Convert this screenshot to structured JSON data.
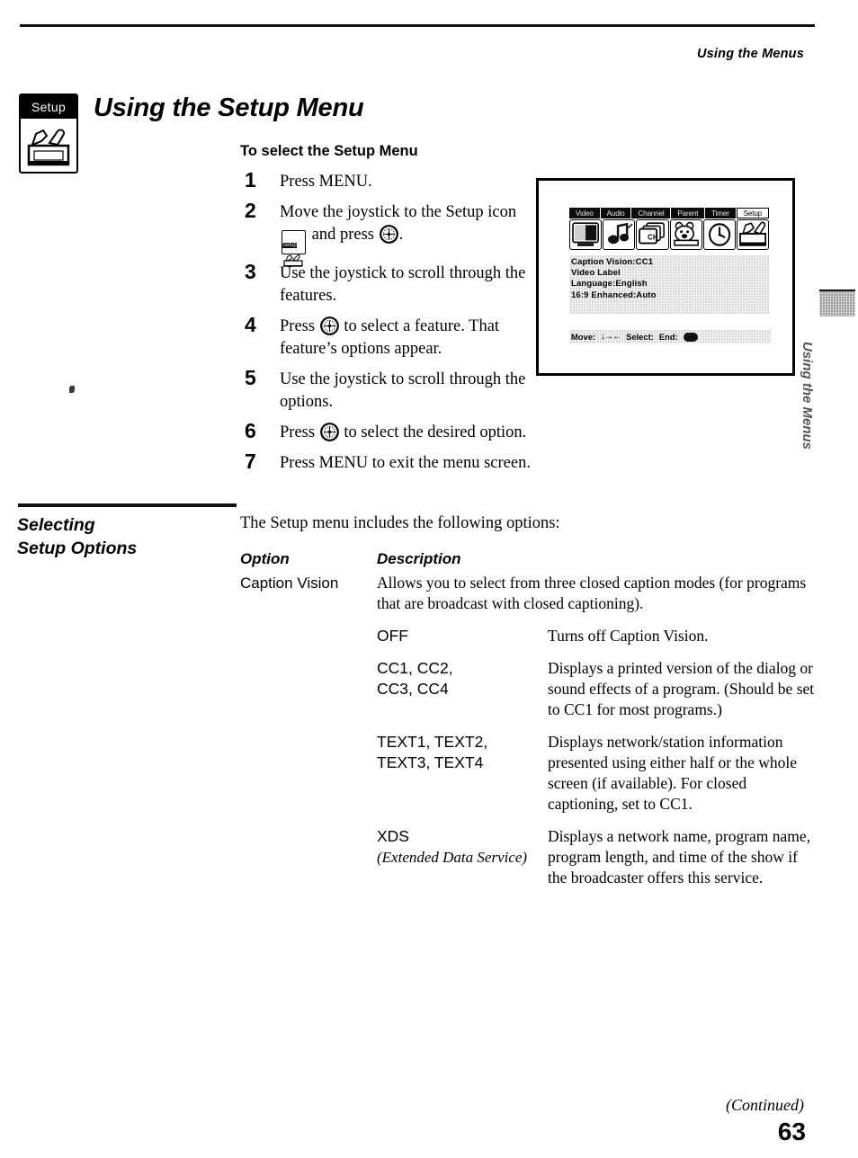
{
  "header": {
    "running_head": "Using the Menus"
  },
  "title": {
    "text": "Using the Setup Menu",
    "margin_icon_label": "Setup"
  },
  "procedure": {
    "subhead": "To select the Setup Menu",
    "steps": [
      {
        "num": "1",
        "before": "Press MENU.",
        "after": "",
        "icons": []
      },
      {
        "num": "2",
        "before": "Move the joystick to the Setup icon",
        "after": "and press",
        "tail": ".",
        "icons": [
          "setup-chip",
          "joystick"
        ]
      },
      {
        "num": "3",
        "before": "Use the joystick to scroll through the features.",
        "after": "",
        "icons": []
      },
      {
        "num": "4",
        "before": "Press",
        "after": "to select a feature. That feature’s options appear.",
        "icons": [
          "joystick"
        ]
      },
      {
        "num": "5",
        "before": "Use the joystick to scroll through the options.",
        "after": "",
        "icons": []
      },
      {
        "num": "6",
        "before": "Press",
        "after": "to select the desired option.",
        "icons": [
          "joystick"
        ]
      },
      {
        "num": "7",
        "before": "Press MENU to exit the menu screen.",
        "after": "",
        "icons": []
      }
    ]
  },
  "tv_screen": {
    "tabs": [
      {
        "label": "Video",
        "selected": false,
        "icon": "video-icon"
      },
      {
        "label": "Audio",
        "selected": false,
        "icon": "audio-note-icon"
      },
      {
        "label": "Channel",
        "selected": false,
        "icon": "channel-cards-icon"
      },
      {
        "label": "Parent",
        "selected": false,
        "icon": "parent-bear-icon"
      },
      {
        "label": "Timer",
        "selected": false,
        "icon": "clock-icon"
      },
      {
        "label": "Setup",
        "selected": true,
        "icon": "setup-toolbox-icon"
      }
    ],
    "menu_items": [
      "Caption Vision:CC1",
      "Video Label",
      "Language:English",
      "16:9 Enhanced:Auto"
    ],
    "footer": {
      "move_label": "Move:",
      "move_arrows": "↓→←",
      "select_label": "Select:",
      "end_label": "End:"
    }
  },
  "side_tab": {
    "text": "Using the Menus"
  },
  "section": {
    "heading_line1": "Selecting",
    "heading_line2": "Setup Options",
    "intro": "The Setup menu includes the following options:",
    "table": {
      "col_option": "Option",
      "col_description": "Description",
      "rows": [
        {
          "option": "Caption Vision",
          "description": "Allows you to select from three closed caption modes (for programs that are broadcast with closed captioning).",
          "suboptions": [
            {
              "label": "OFF",
              "note": "",
              "description": "Turns off Caption Vision."
            },
            {
              "label": "CC1, CC2,\nCC3, CC4",
              "note": "",
              "description": "Displays a printed version of the dialog or sound effects of a program. (Should be set to CC1 for most programs.)"
            },
            {
              "label": "TEXT1, TEXT2,\nTEXT3, TEXT4",
              "note": "",
              "description": "Displays network/station information presented using either half or the whole screen (if available). For closed captioning, set to CC1."
            },
            {
              "label": "XDS",
              "note": "(Extended Data Service)",
              "description": "Displays a network name, program name, program length, and time of the show if the broadcaster offers this service."
            }
          ]
        }
      ]
    }
  },
  "footer": {
    "continued": "(Continued)",
    "page_number": "63"
  }
}
